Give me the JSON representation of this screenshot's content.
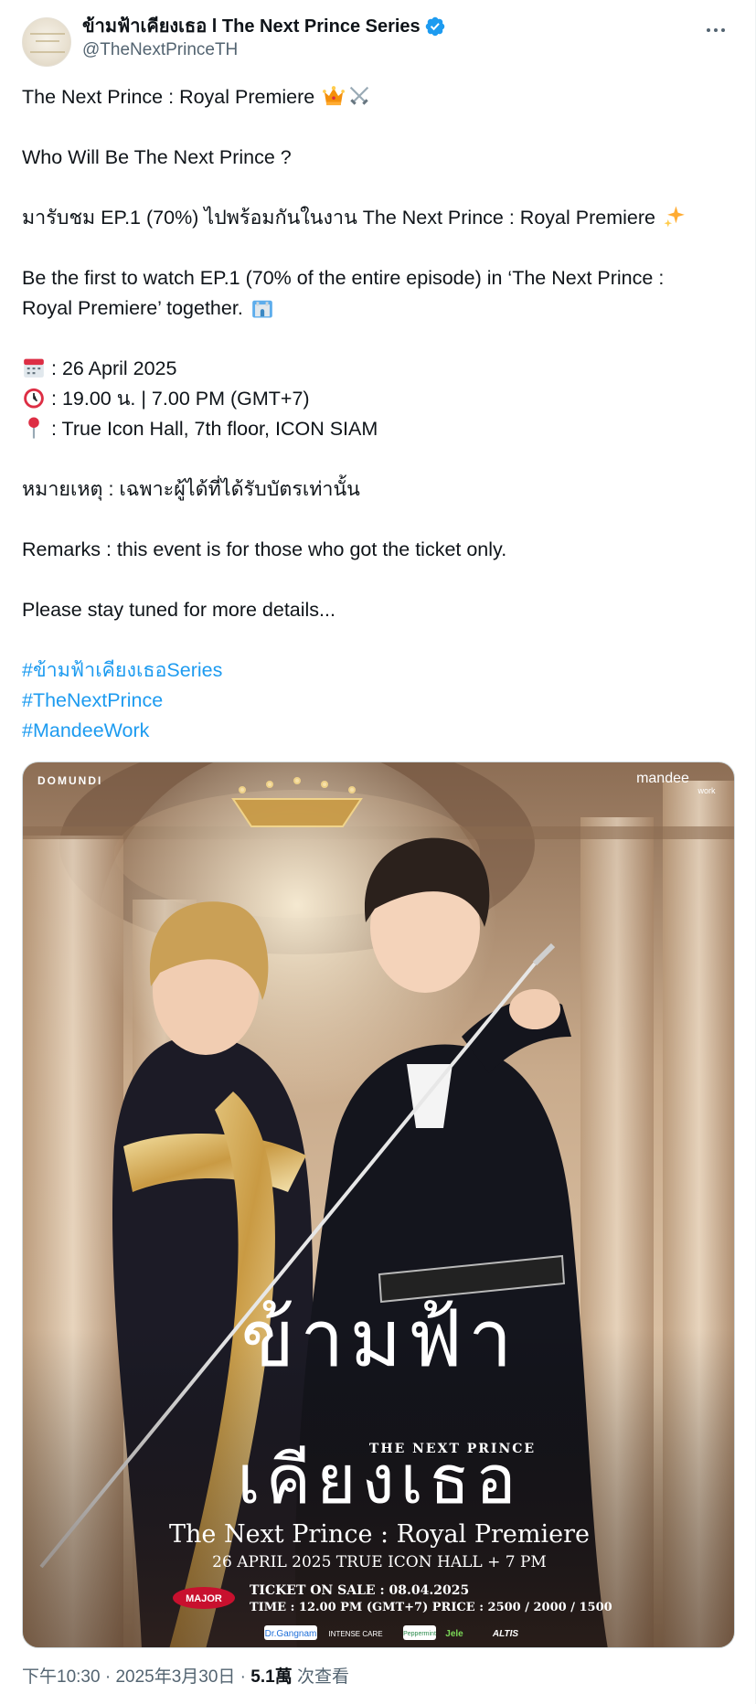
{
  "author": {
    "display_name": "ข้ามฟ้าเคียงเธอ l The Next Prince Series",
    "handle": "@TheNextPrinceTH",
    "verified_icon": "verified-badge-icon",
    "verified_color": "#1d9bf0"
  },
  "tweet": {
    "lines": [
      "The Next Prince : Royal Premiere",
      "Who Will Be The Next Prince ?",
      "มารับชม EP.1 (70%) ไปพร้อมกันในงาน The Next Prince : Royal Premiere",
      "Be the first to watch EP.1 (70% of the entire episode) in ‘The Next Prince :",
      "Royal Premiere’ together.",
      ": 26 April 2025",
      ": 19.00 น. | 7.00 PM (GMT+7)",
      ": True Icon Hall, 7th floor, ICON SIAM",
      "หมายเหตุ : เฉพาะผู้ได้ที่ได้รับบัตรเท่านั้น",
      "Remarks : this event is for those who got the ticket only.",
      "Please stay tuned for more details..."
    ],
    "hashtags": [
      "#ข้ามฟ้าเคียงเธอSeries",
      "#TheNextPrince",
      "#MandeeWork"
    ],
    "emojis": {
      "line1": [
        "crown-emoji",
        "crossed-swords-emoji"
      ],
      "line3": "sparkles-emoji",
      "line5": "castle-emoji",
      "date": "calendar-emoji",
      "time": "alarm-clock-emoji",
      "location": "round-pushpin-emoji"
    }
  },
  "poster": {
    "brand_left": "DOMUNDI",
    "brand_right": "mandee",
    "brand_right_sub": "work",
    "title_thai_line1": "ข้ามฟ้า",
    "title_thai_line2": "เคียงเธอ",
    "title_en": "THE NEXT PRINCE",
    "event_name": "The Next Prince : Royal Premiere",
    "event_details": "26 APRIL 2025   TRUE ICON HALL  +  7 PM",
    "ticket_line": "TICKET ON SALE : 08.04.2025",
    "time_price_line": "TIME : 12.00 PM (GMT+7)   PRICE : 2500 / 2000 / 1500",
    "sponsor_major": "MAJOR",
    "sponsors": [
      "Dr.Gangnam",
      "INTENSE CARE",
      "Peppermint",
      "Jele",
      "ALTIS"
    ]
  },
  "footer": {
    "time": "下午10:30",
    "sep": " · ",
    "date": "2025年3月30日",
    "views_count": "5.1萬",
    "views_label": " 次查看"
  }
}
